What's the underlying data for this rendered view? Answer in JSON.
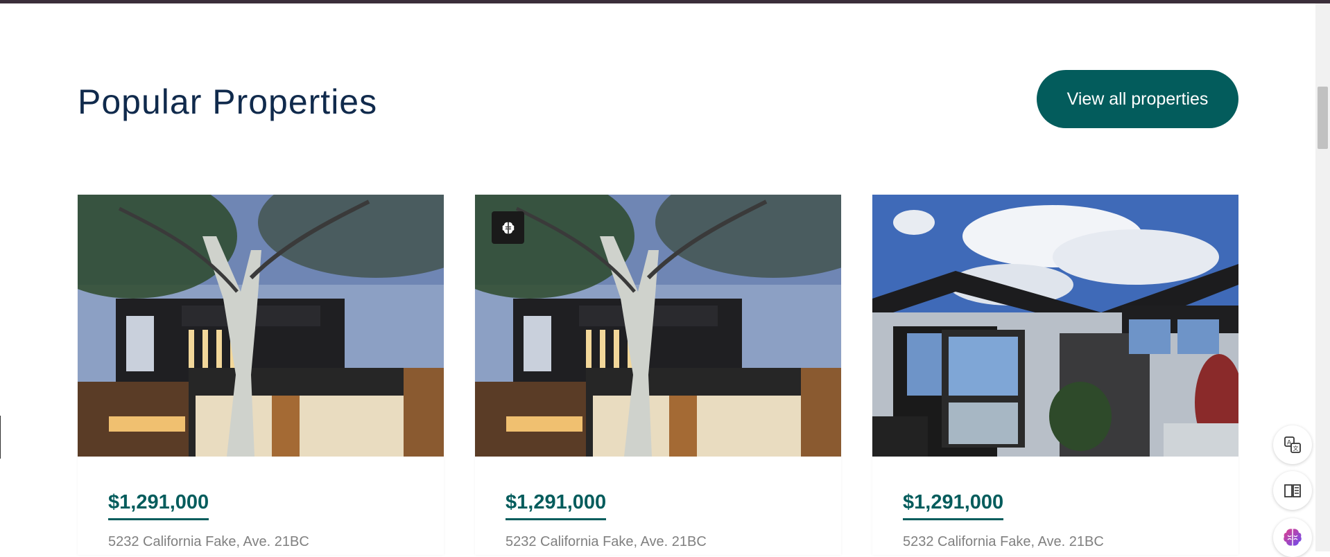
{
  "section": {
    "title": "Popular Properties",
    "view_all_label": "View all properties"
  },
  "properties": [
    {
      "price": "$1,291,000",
      "address": "5232 California Fake, Ave. 21BC",
      "image": "modern-house-with-tree"
    },
    {
      "price": "$1,291,000",
      "address": "5232 California Fake, Ave. 21BC",
      "image": "modern-house-with-tree",
      "badge_icon": "brain-icon"
    },
    {
      "price": "$1,291,000",
      "address": "5232 California Fake, Ave. 21BC",
      "image": "modern-house-cloudy-sky"
    }
  ],
  "floating_tools": [
    {
      "icon": "translate-icon"
    },
    {
      "icon": "reader-book-icon"
    },
    {
      "icon": "brain-assistant-icon"
    }
  ],
  "colors": {
    "accent": "#035c5c",
    "heading": "#102a4c",
    "address": "#808080"
  }
}
